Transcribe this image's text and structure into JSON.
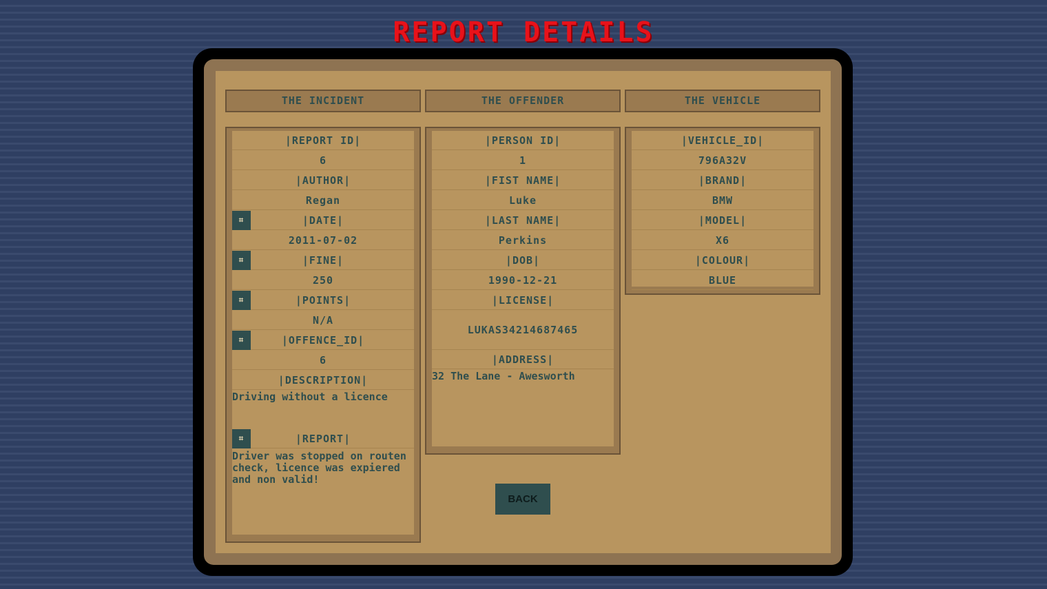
{
  "title": "REPORT DETAILS",
  "columns": {
    "incident": "THE INCIDENT",
    "offender": "THE OFFENDER",
    "vehicle": "THE VEHICLE"
  },
  "incident": {
    "report_id_label": "|REPORT ID|",
    "report_id": "6",
    "author_label": "|AUTHOR|",
    "author": "Regan",
    "date_label": "|DATE|",
    "date": "2011-07-02",
    "fine_label": "|FINE|",
    "fine": "250",
    "points_label": "|POINTS|",
    "points": "N/A",
    "offence_id_label": "|OFFENCE_ID|",
    "offence_id": "6",
    "description_label": "|DESCRIPTION|",
    "description": "Driving without a licence",
    "report_label": "|REPORT|",
    "report": "Driver was stopped on routen check, licence was expiered and non valid!",
    "edit_glyph": "⌗"
  },
  "offender": {
    "person_id_label": "|PERSON ID|",
    "person_id": "1",
    "first_name_label": "|FIST NAME|",
    "first_name": "Luke",
    "last_name_label": "|LAST NAME|",
    "last_name": "Perkins",
    "dob_label": "|DOB|",
    "dob": "1990-12-21",
    "license_label": "|LICENSE|",
    "license": "LUKAS34214687465",
    "address_label": "|ADDRESS|",
    "address": "32 The Lane - Awesworth"
  },
  "vehicle": {
    "vehicle_id_label": "|VEHICLE_ID|",
    "vehicle_id": "796A32V",
    "brand_label": "|BRAND|",
    "brand": "BMW",
    "model_label": "|MODEL|",
    "model": "X6",
    "colour_label": "|COLOUR|",
    "colour": "BLUE"
  },
  "back_label": "BACK",
  "colors": {
    "background": "#2f3f62",
    "title": "#e8121a",
    "panel": "#b8955f",
    "text": "#2f4e4e",
    "button": "#2f4e4e"
  }
}
